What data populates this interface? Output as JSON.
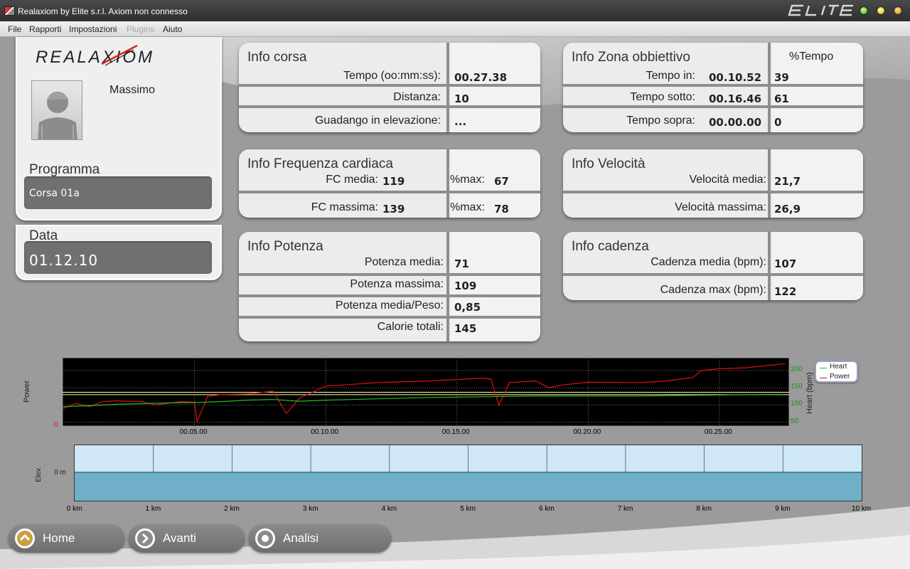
{
  "window": {
    "title": "Realaxiom by Elite s.r.l. Axiom non connesso",
    "brand": "ELITE"
  },
  "menu": [
    "File",
    "Rapporti",
    "Impostazioni",
    "Plugins",
    "Aiuto"
  ],
  "left": {
    "logo": "REALAXIOM",
    "user_name": "Massimo",
    "program_label": "Programma",
    "program_value": "Corsa 01a",
    "date_label": "Data",
    "date_value": "01.12.10"
  },
  "info_corsa": {
    "title": "Info corsa",
    "rows": [
      {
        "label": "Tempo (oo:mm:ss):",
        "value": "00.27.38"
      },
      {
        "label": "Distanza:",
        "value": "10"
      },
      {
        "label": "Guadango in elevazione:",
        "value": "..."
      }
    ]
  },
  "info_zona": {
    "title": "Info Zona obbiettivo",
    "pct_header": "%Tempo",
    "rows": [
      {
        "label": "Tempo in:",
        "time": "00.10.52",
        "pct": "39"
      },
      {
        "label": "Tempo sotto:",
        "time": "00.16.46",
        "pct": "61"
      },
      {
        "label": "Tempo sopra:",
        "time": "00.00.00",
        "pct": "0"
      }
    ]
  },
  "info_fc": {
    "title": "Info Frequenza cardiaca",
    "rows": [
      {
        "label": "FC media:",
        "value": "119",
        "pct_label": "%max:",
        "pct": "67"
      },
      {
        "label": "FC massima:",
        "value": "139",
        "pct_label": "%max:",
        "pct": "78"
      }
    ]
  },
  "info_velocita": {
    "title": "Info Velocità",
    "rows": [
      {
        "label": "Velocità media:",
        "value": "21,7"
      },
      {
        "label": "Velocità massima:",
        "value": "26,9"
      }
    ]
  },
  "info_potenza": {
    "title": "Info Potenza",
    "rows": [
      {
        "label": "Potenza media:",
        "value": "71"
      },
      {
        "label": "Potenza massima:",
        "value": "109"
      },
      {
        "label": "Potenza media/Peso:",
        "value": "0,85"
      },
      {
        "label": "Calorie totali:",
        "value": "145"
      }
    ]
  },
  "info_cadenza": {
    "title": "Info cadenza",
    "rows": [
      {
        "label": "Cadenza media (bpm):",
        "value": "107"
      },
      {
        "label": "Cadenza max (bpm):",
        "value": "122"
      }
    ]
  },
  "chart_data": [
    {
      "type": "line",
      "ylabel": "Power",
      "y2label": "Heart (bpm)",
      "y_left_ticks": [
        "0"
      ],
      "y_right_ticks": [
        "200",
        "150",
        "100",
        "50"
      ],
      "y_right_range": [
        41,
        235
      ],
      "x_ticks": [
        "00.05.00",
        "00.10.00",
        "00.15.00",
        "00.20.00",
        "00.25.00"
      ],
      "x_range_min": [
        0,
        27.63
      ],
      "legend": {
        "placement": "right",
        "entries": [
          "Heart",
          "Power"
        ]
      },
      "colors": {
        "Heart": "#20c020",
        "Power": "#e01010",
        "ref_line": "#ffffaa"
      },
      "reference_lines_bpm": [
        137,
        130
      ],
      "series": [
        {
          "name": "Power",
          "x": [
            0,
            0.5,
            1,
            1.5,
            2,
            3,
            3.5,
            4,
            4.5,
            5,
            5.1,
            5.5,
            6,
            7,
            8,
            8.5,
            9,
            10,
            12,
            14,
            16,
            16.3,
            16.6,
            17,
            18,
            18.5,
            19,
            20,
            22,
            23,
            24,
            24.3,
            25,
            26,
            27.5
          ],
          "y": [
            90,
            105,
            95,
            110,
            112,
            110,
            100,
            105,
            110,
            108,
            52,
            125,
            130,
            132,
            140,
            75,
            120,
            155,
            165,
            170,
            178,
            175,
            100,
            165,
            170,
            150,
            158,
            166,
            165,
            170,
            180,
            200,
            205,
            208,
            220
          ]
        },
        {
          "name": "Heart",
          "x": [
            0,
            1,
            2,
            3,
            4,
            5,
            6,
            7,
            8,
            9,
            10,
            12,
            14,
            16,
            18,
            20,
            22,
            24,
            26,
            27.5
          ],
          "y": [
            95,
            98,
            102,
            104,
            106,
            107,
            110,
            114,
            116,
            111,
            114,
            118,
            122,
            124,
            126,
            126,
            126,
            128,
            130,
            131
          ]
        }
      ]
    },
    {
      "type": "area",
      "ylabel": "Elev.",
      "y_ticks": [
        "0 m"
      ],
      "x_ticks": [
        "0 km",
        "1 km",
        "2 km",
        "3 km",
        "4 km",
        "5 km",
        "6 km",
        "7 km",
        "8 km",
        "9 km",
        "10 km"
      ],
      "x_range_km": [
        0,
        10
      ],
      "colors": {
        "sky": "#cfe7f6",
        "fill": "#6fb0c8",
        "line": "#1b6b4f"
      },
      "series": [
        {
          "x": [
            0,
            10
          ],
          "y": [
            0,
            0
          ]
        }
      ]
    }
  ],
  "nav": [
    {
      "label": "Home",
      "icon": "chevron-up-icon"
    },
    {
      "label": "Avanti",
      "icon": "chevron-right-icon"
    },
    {
      "label": "Analisi",
      "icon": "record-icon"
    }
  ]
}
